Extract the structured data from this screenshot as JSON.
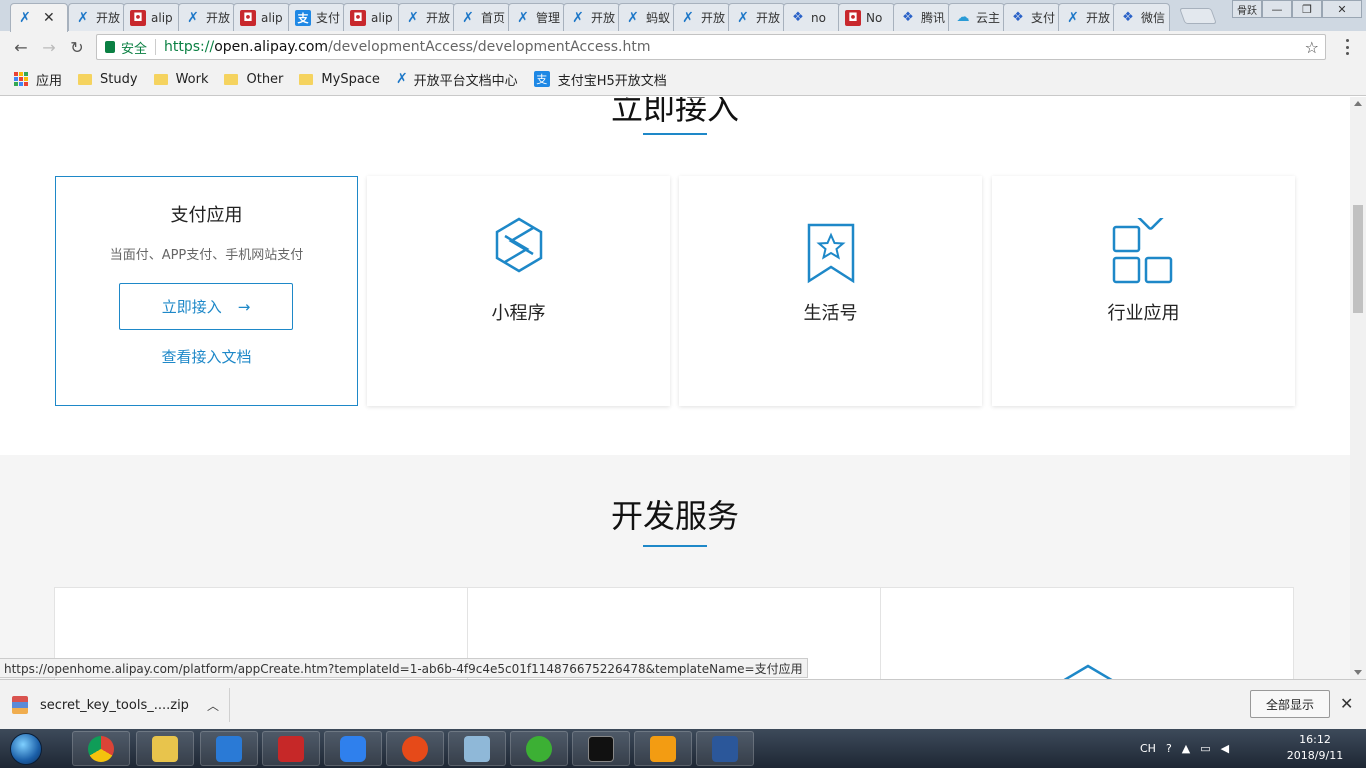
{
  "tabs": [
    {
      "title": "",
      "icon": "ant",
      "active": true
    },
    {
      "title": "开放",
      "icon": "ant"
    },
    {
      "title": "alip",
      "icon": "red"
    },
    {
      "title": "开放",
      "icon": "ant"
    },
    {
      "title": "alip",
      "icon": "red"
    },
    {
      "title": "支付",
      "icon": "blue"
    },
    {
      "title": "alip",
      "icon": "red"
    },
    {
      "title": "开放",
      "icon": "ant"
    },
    {
      "title": "首页",
      "icon": "ant"
    },
    {
      "title": "管理",
      "icon": "ant"
    },
    {
      "title": "开放",
      "icon": "ant"
    },
    {
      "title": "蚂蚁",
      "icon": "ant"
    },
    {
      "title": "开放",
      "icon": "ant"
    },
    {
      "title": "开放",
      "icon": "ant"
    },
    {
      "title": "no",
      "icon": "paw"
    },
    {
      "title": "No",
      "icon": "red"
    },
    {
      "title": "腾讯",
      "icon": "paw"
    },
    {
      "title": "云主",
      "icon": "cloud"
    },
    {
      "title": "支付",
      "icon": "paw"
    },
    {
      "title": "开放",
      "icon": "ant"
    },
    {
      "title": "微信",
      "icon": "paw"
    }
  ],
  "window": {
    "user_label": "骨跃"
  },
  "address": {
    "secure_label": "安全",
    "scheme": "https://",
    "host": "open.alipay.com",
    "path": "/developmentAccess/developmentAccess.htm"
  },
  "bookmarks": [
    {
      "label": "应用",
      "type": "apps"
    },
    {
      "label": "Study",
      "type": "folder"
    },
    {
      "label": "Work",
      "type": "folder"
    },
    {
      "label": "Other",
      "type": "folder"
    },
    {
      "label": "MySpace",
      "type": "folder"
    },
    {
      "label": "开放平台文档中心",
      "type": "ant"
    },
    {
      "label": "支付宝H5开放文档",
      "type": "zfb"
    }
  ],
  "section1": {
    "title": "立即接入",
    "card_pay": {
      "title": "支付应用",
      "desc": "当面付、APP支付、手机网站支付",
      "button": "立即接入",
      "button_arrow": "→",
      "link": "查看接入文档"
    },
    "cards": [
      {
        "name": "小程序",
        "icon": "mini-program-icon"
      },
      {
        "name": "生活号",
        "icon": "life-account-icon"
      },
      {
        "name": "行业应用",
        "icon": "industry-app-icon"
      }
    ]
  },
  "section2": {
    "title": "开发服务"
  },
  "status_url": "https://openhome.alipay.com/platform/appCreate.htm?templateId=1-ab6b-4f9c4e5c01f114876675226478&templateName=支付应用",
  "download": {
    "filename": "secret_key_tools_....zip",
    "show_all": "全部显示"
  },
  "taskbar": {
    "tray_lang": "CH",
    "time": "16:12",
    "date": "2018/9/11"
  },
  "colors": {
    "accent": "#1e88c8",
    "secure": "#0b8043"
  }
}
